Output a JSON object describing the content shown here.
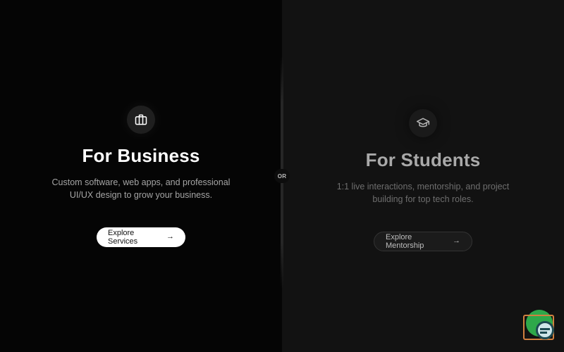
{
  "business": {
    "icon": "briefcase-icon",
    "title": "For Business",
    "description": "Custom software, web apps, and professional UI/UX design to grow your business.",
    "button_label": "Explore Services",
    "button_arrow": "→"
  },
  "divider": {
    "label": "OR"
  },
  "students": {
    "icon": "graduation-cap-icon",
    "title": "For Students",
    "description": "1:1 live interactions, mentorship, and project building for top tech roles.",
    "button_label": "Explore Mentorship",
    "button_arrow": "→"
  },
  "colors": {
    "business_bg": "#050505",
    "students_bg": "#121212",
    "business_title": "#ffffff",
    "students_title": "#a9a9a9",
    "primary_button_bg": "#ffffff"
  }
}
